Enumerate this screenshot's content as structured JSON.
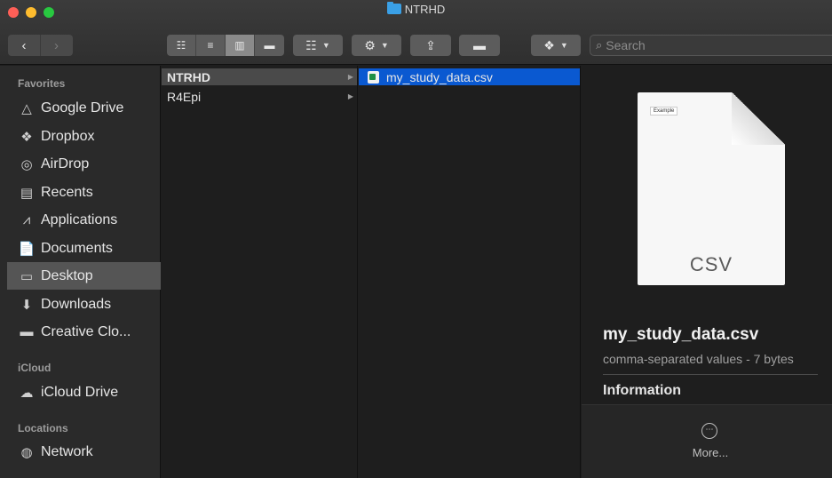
{
  "window": {
    "title": "NTRHD"
  },
  "toolbar": {
    "back_icon": "chevron-left",
    "forward_icon": "chevron-right",
    "view_modes": [
      "icon-view",
      "list-view",
      "column-view",
      "gallery-view"
    ],
    "active_view": "column-view",
    "search_placeholder": "Search"
  },
  "sidebar": {
    "favorites_heading": "Favorites",
    "favorites": [
      {
        "label": "Google Drive",
        "icon": "google-drive-icon"
      },
      {
        "label": "Dropbox",
        "icon": "dropbox-icon"
      },
      {
        "label": "AirDrop",
        "icon": "airdrop-icon"
      },
      {
        "label": "Recents",
        "icon": "recents-icon"
      },
      {
        "label": "Applications",
        "icon": "applications-icon"
      },
      {
        "label": "Documents",
        "icon": "documents-icon"
      },
      {
        "label": "Desktop",
        "icon": "desktop-icon",
        "selected": true
      },
      {
        "label": "Downloads",
        "icon": "downloads-icon"
      },
      {
        "label": "Creative Clo...",
        "icon": "folder-icon"
      }
    ],
    "icloud_heading": "iCloud",
    "icloud": [
      {
        "label": "iCloud Drive",
        "icon": "cloud-icon"
      }
    ],
    "locations_heading": "Locations",
    "locations": [
      {
        "label": "Network",
        "icon": "network-icon"
      }
    ]
  },
  "column1": {
    "items": [
      {
        "label": "NTRHD",
        "selected": true
      },
      {
        "label": "R4Epi"
      }
    ]
  },
  "column2": {
    "items": [
      {
        "label": "my_study_data.csv",
        "selected": true
      }
    ]
  },
  "preview": {
    "thumb_label": "Example",
    "thumb_ext": "CSV",
    "filename": "my_study_data.csv",
    "kind": "comma-separated values - 7 bytes",
    "info_heading": "Information",
    "more_label": "More..."
  },
  "colors": {
    "selection_blue": "#0a59d1",
    "sidebar_bg": "#2a2a2a",
    "window_bg": "#1e1e1e"
  }
}
